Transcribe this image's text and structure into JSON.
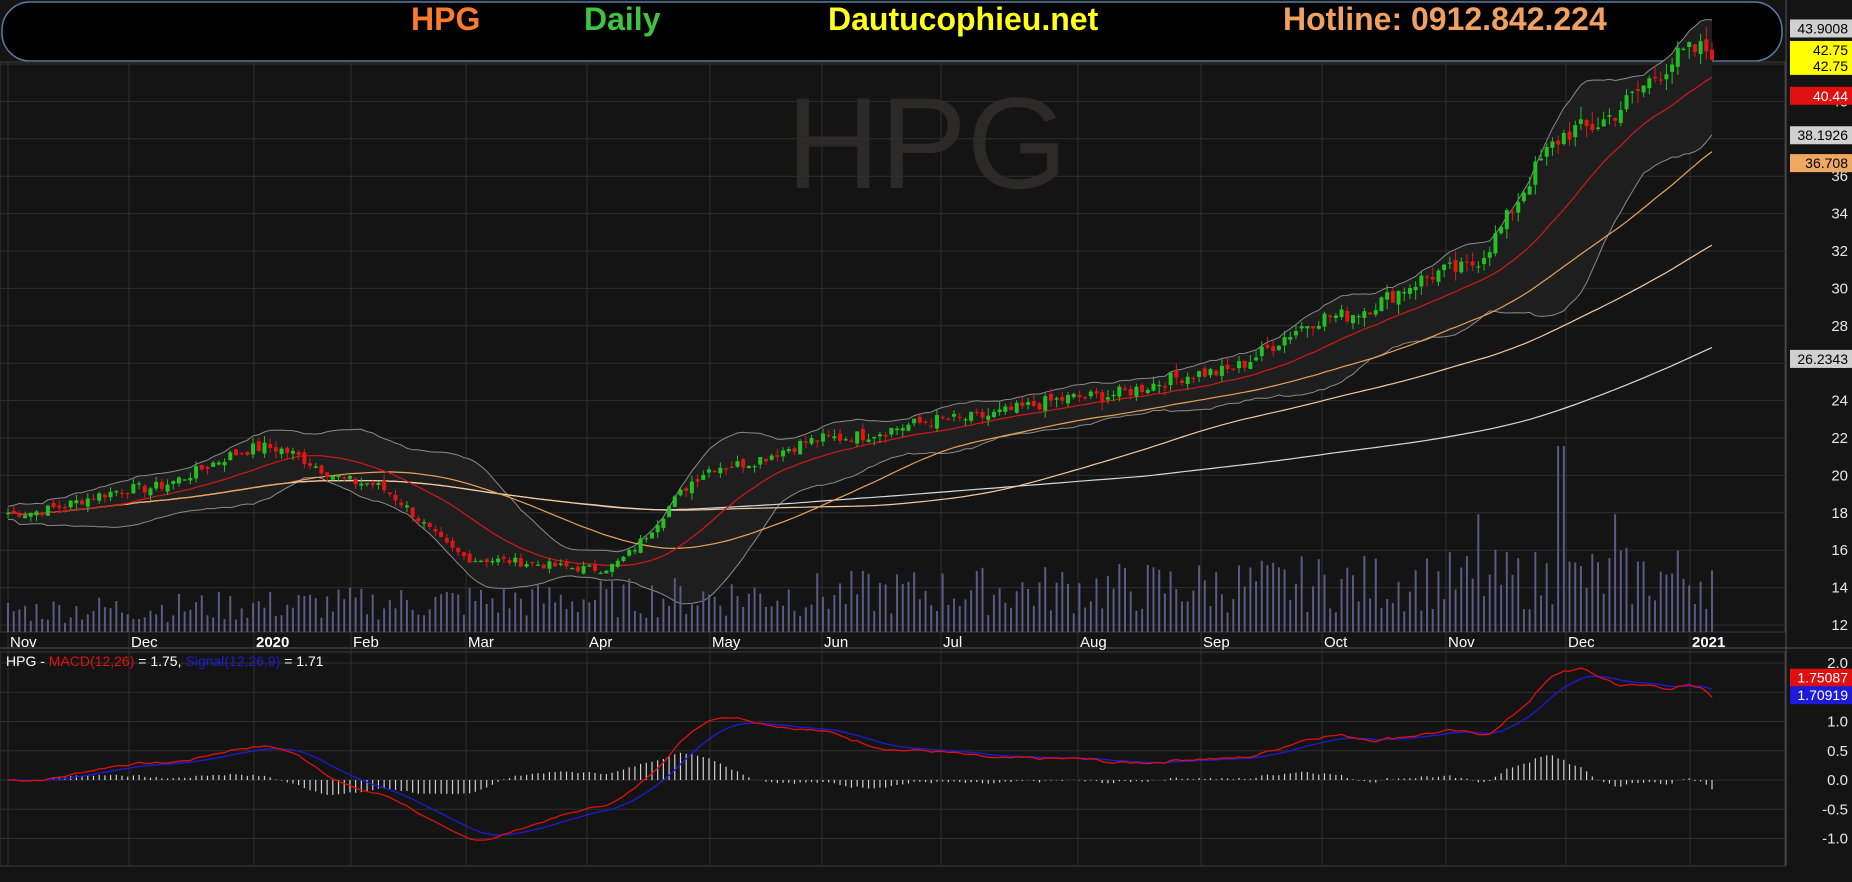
{
  "banner": {
    "symbol": "HPG",
    "timeframe": "Daily",
    "site": "Dautucophieu.net",
    "hotline": "Hotline: 0912.842.224"
  },
  "watermark": "HPG",
  "colors": {
    "background": "#141414",
    "grid": "#2e2e2e",
    "up": "#22c022",
    "down": "#e01616",
    "ma20": "#d01818",
    "ma50": "#e8a25a",
    "ma100": "#f2c9a0",
    "ma200": "#d8d8d8",
    "bollinger": "#8a8a8a",
    "volume": "#5a5a82",
    "macd": "#e01010",
    "signal": "#1c1cd8",
    "histogram": "#cfcfcf"
  },
  "x_axis": {
    "months": [
      "Nov",
      "Dec",
      "2020",
      "Feb",
      "Mar",
      "Apr",
      "May",
      "Jun",
      "Jul",
      "Aug",
      "Sep",
      "Oct",
      "Nov",
      "Dec",
      "2021"
    ]
  },
  "price_axis": {
    "ticks": [
      "12",
      "14",
      "16",
      "18",
      "20",
      "22",
      "24",
      "26",
      "28",
      "30",
      "32",
      "34",
      "36",
      "38",
      "40",
      "42"
    ]
  },
  "price_labels": [
    {
      "text": "43.9008",
      "price": 43.9,
      "bg": "#d0d0d0",
      "fg": "#000000"
    },
    {
      "text": "42.75",
      "price": 42.75,
      "bg": "#ffff00",
      "fg": "#000000"
    },
    {
      "text": "42.75",
      "price": 41.9,
      "bg": "#ffff00",
      "fg": "#000000"
    },
    {
      "text": "40.44",
      "price": 40.3,
      "bg": "#e01010",
      "fg": "#ffffff"
    },
    {
      "text": "38.1926",
      "price": 38.19,
      "bg": "#d0d0d0",
      "fg": "#000000"
    },
    {
      "text": "36.708",
      "price": 36.7,
      "bg": "#f0a860",
      "fg": "#000000"
    },
    {
      "text": "26.2343",
      "price": 26.23,
      "bg": "#d0d0d0",
      "fg": "#000000"
    }
  ],
  "macd_axis": {
    "ticks": [
      "2.0",
      "1.5",
      "1.0",
      "0.5",
      "0.0",
      "-0.5",
      "-1.0"
    ]
  },
  "macd_header": {
    "symbol": "HPG",
    "sep": " - ",
    "macd_label": "MACD(12,26)",
    "macd_value": " = 1.75, ",
    "signal_label": "Signal(12,26,9)",
    "signal_value": " = 1.71"
  },
  "macd_value_labels": [
    {
      "text": "1.75087",
      "value": 1.75,
      "bg": "#e01010",
      "fg": "#ffffff"
    },
    {
      "text": "1.70919",
      "value": 1.45,
      "bg": "#1c1cd8",
      "fg": "#ffffff"
    }
  ],
  "chart_data": [
    {
      "type": "candlestick",
      "title": "HPG Daily",
      "x": "Nov 2019 - Jan 2021 (monthly anchors)",
      "ylim": [
        11,
        44
      ],
      "grid": true,
      "close_path": [
        {
          "month": "Nov 2019",
          "close": 18.0
        },
        {
          "month": "Dec 2019",
          "close": 19.3
        },
        {
          "month": "Jan 2020",
          "close": 21.5
        },
        {
          "month": "Feb 2020",
          "close": 19.6
        },
        {
          "month": "Mar 2020",
          "close": 15.5
        },
        {
          "month": "Apr 2020",
          "close": 15.0
        },
        {
          "month": "May 2020",
          "close": 20.5
        },
        {
          "month": "Jun 2020",
          "close": 22.0
        },
        {
          "month": "Jul 2020",
          "close": 23.0
        },
        {
          "month": "Aug 2020",
          "close": 24.2
        },
        {
          "month": "Sep 2020",
          "close": 25.5
        },
        {
          "month": "Oct 2020",
          "close": 28.5
        },
        {
          "month": "Nov 2020",
          "close": 31.0
        },
        {
          "month": "Dec 2020",
          "close": 38.5
        },
        {
          "month": "Jan 2021",
          "close": 42.75
        }
      ],
      "indicators": {
        "ma20_last": 40.44,
        "bollinger_upper_last": 43.9008,
        "bollinger_lower_last": 38.1926,
        "ma50_last": 36.708,
        "ma200_last": 26.2343
      }
    },
    {
      "type": "line",
      "title": "HPG - MACD(12,26) = 1.75, Signal(12,26,9) = 1.71",
      "ylim": [
        -1.2,
        2.0
      ],
      "series": [
        {
          "name": "MACD(12,26)",
          "last": 1.75
        },
        {
          "name": "Signal(12,26,9)",
          "last": 1.71
        }
      ]
    }
  ]
}
